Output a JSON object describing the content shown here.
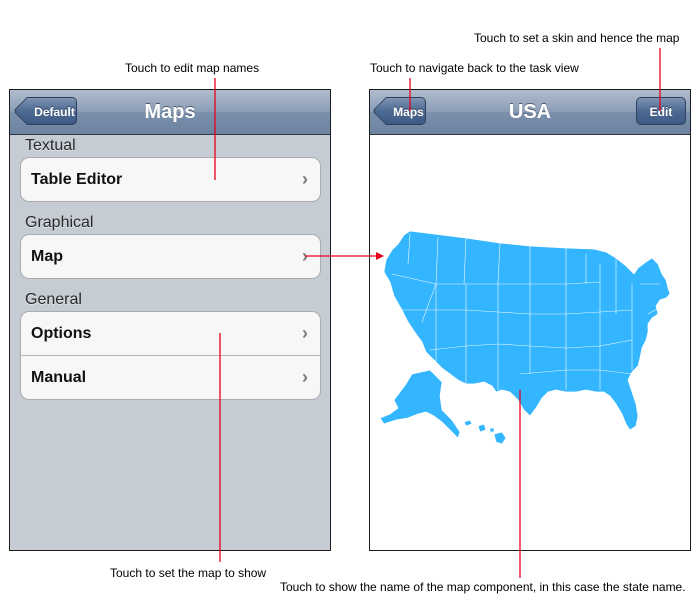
{
  "callouts": {
    "skin": "Touch to set a skin and hence the map",
    "edit_names": "Touch to edit map names",
    "navigate_back": "Touch to navigate back to the task view",
    "set_map": "Touch to set the map to show",
    "show_name": "Touch to show the name of the map component, in this case the state name."
  },
  "left_screen": {
    "back_button": "Default",
    "title": "Maps",
    "sections": {
      "textual": "Textual",
      "graphical": "Graphical",
      "general": "General"
    },
    "rows": {
      "table_editor": "Table Editor",
      "map": "Map",
      "options": "Options",
      "manual": "Manual"
    },
    "chevron": "›"
  },
  "right_screen": {
    "back_button": "Maps",
    "title": "USA",
    "edit_button": "Edit"
  },
  "colors": {
    "map_fill": "#33b6ff",
    "annotation_line": "#e8001c",
    "navbar": "#7a8fab",
    "table_background": "#c5ccd4"
  }
}
